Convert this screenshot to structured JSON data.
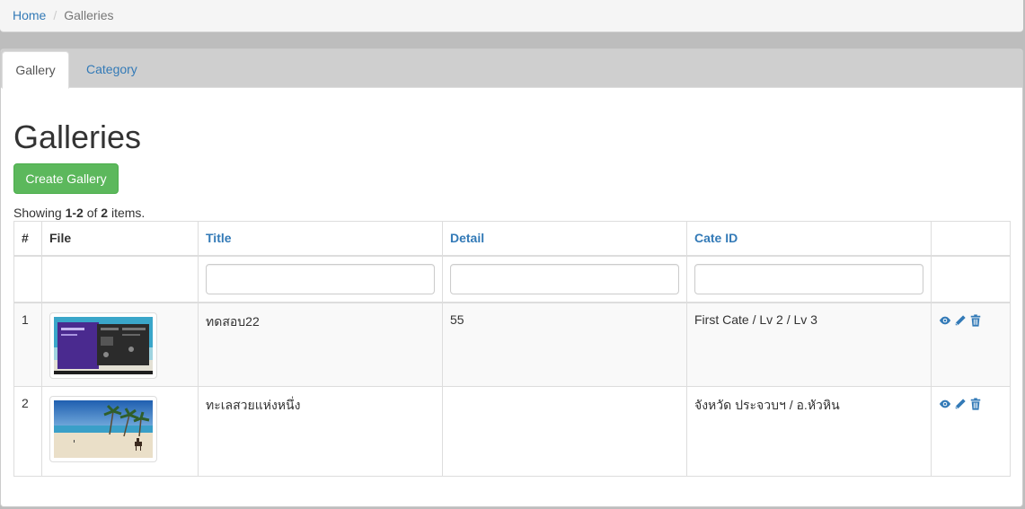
{
  "breadcrumb": {
    "home": "Home",
    "separator": "/",
    "current": "Galleries"
  },
  "tabs": [
    {
      "label": "Gallery",
      "active": true
    },
    {
      "label": "Category",
      "active": false
    }
  ],
  "page": {
    "title": "Galleries",
    "create_button": "Create Gallery",
    "summary_prefix": "Showing ",
    "summary_range": "1-2",
    "summary_mid": " of ",
    "summary_total": "2",
    "summary_suffix": " items."
  },
  "table": {
    "columns": [
      "#",
      "File",
      "Title",
      "Detail",
      "Cate ID",
      ""
    ],
    "filters": {
      "title": "",
      "detail": "",
      "cate_id": ""
    },
    "rows": [
      {
        "num": "1",
        "thumb": "windows-desktop-screenshot",
        "title": "ทดสอบ22",
        "detail": "55",
        "cate": "First Cate / Lv 2 / Lv 3"
      },
      {
        "num": "2",
        "thumb": "beach-photo",
        "title": "ทะเลสวยแห่งหนึ่ง",
        "detail": "",
        "cate": "จังหวัด ประจวบฯ / อ.หัวหิน"
      }
    ]
  },
  "colors": {
    "link": "#337ab7",
    "success": "#5cb85c",
    "tabbar": "#cfcfcf"
  },
  "icons": {
    "view": "eye-icon",
    "edit": "pencil-icon",
    "delete": "trash-icon"
  }
}
